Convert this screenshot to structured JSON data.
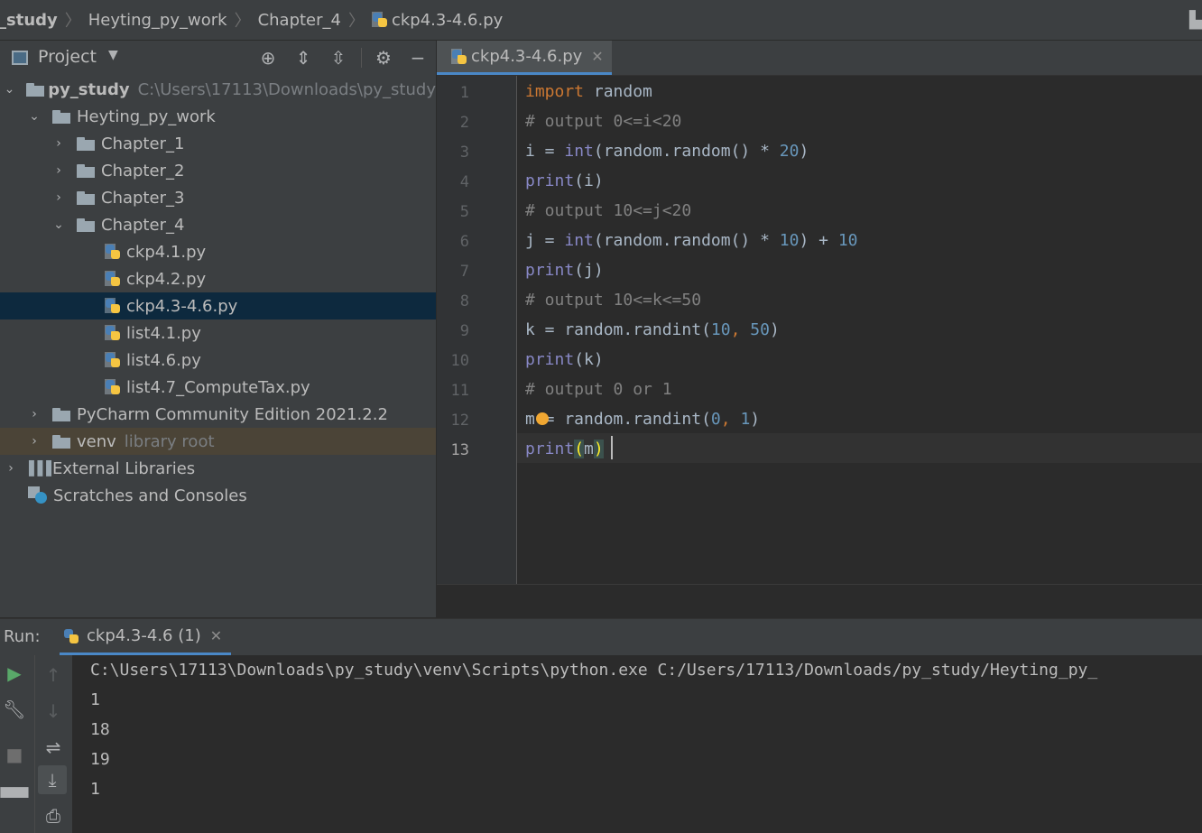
{
  "breadcrumb": {
    "items": [
      "py_study",
      "Heyting_py_work",
      "Chapter_4",
      "ckp4.3-4.6.py"
    ],
    "visible_first": "_study"
  },
  "project_panel": {
    "view_label": "Project",
    "tree": [
      {
        "label": "py_study",
        "hint": "C:\\Users\\17113\\Downloads\\py_study",
        "kind": "folder",
        "expanded": true
      },
      {
        "label": "Heyting_py_work",
        "kind": "folder",
        "expanded": true
      },
      {
        "label": "Chapter_1",
        "kind": "folder",
        "expanded": false
      },
      {
        "label": "Chapter_2",
        "kind": "folder",
        "expanded": false
      },
      {
        "label": "Chapter_3",
        "kind": "folder",
        "expanded": false
      },
      {
        "label": "Chapter_4",
        "kind": "folder",
        "expanded": true
      },
      {
        "label": "ckp4.1.py",
        "kind": "python-file"
      },
      {
        "label": "ckp4.2.py",
        "kind": "python-file"
      },
      {
        "label": "ckp4.3-4.6.py",
        "kind": "python-file",
        "selected": true
      },
      {
        "label": "list4.1.py",
        "kind": "python-file"
      },
      {
        "label": "list4.6.py",
        "kind": "python-file"
      },
      {
        "label": "list4.7_ComputeTax.py",
        "kind": "python-file"
      },
      {
        "label": "PyCharm Community Edition 2021.2.2",
        "kind": "folder",
        "expanded": false
      },
      {
        "label": "venv",
        "hint": "library root",
        "kind": "folder",
        "expanded": false
      },
      {
        "label": "External Libraries",
        "kind": "libraries",
        "expanded": false
      },
      {
        "label": "Scratches and Consoles",
        "kind": "scratches"
      }
    ]
  },
  "editor": {
    "tab_label": "ckp4.3-4.6.py",
    "current_line": 13,
    "line_numbers": [
      "1",
      "2",
      "3",
      "4",
      "5",
      "6",
      "7",
      "8",
      "9",
      "10",
      "11",
      "12",
      "13"
    ],
    "lines": [
      "import random",
      "# output 0<=i<20",
      "i = int(random.random() * 20)",
      "print(i)",
      "# output 10<=j<20",
      "j = int(random.random() * 10) + 10",
      "print(j)",
      "# output 10<=k<=50",
      "k = random.randint(10, 50)",
      "print(k)",
      "# output 0 or 1",
      "m = random.randint(0, 1)",
      "print(m)"
    ]
  },
  "run_panel": {
    "label": "Run:",
    "tab_label": "ckp4.3-4.6 (1)",
    "output": [
      "C:\\Users\\17113\\Downloads\\py_study\\venv\\Scripts\\python.exe C:/Users/17113/Downloads/py_study/Heyting_py_",
      "1",
      "18",
      "19",
      "1"
    ]
  },
  "colors": {
    "keyword": "#cc7832",
    "comment": "#808080",
    "number": "#6897bb",
    "builtin": "#8888c6",
    "selection": "#0d293e",
    "accent": "#4a88c7"
  }
}
